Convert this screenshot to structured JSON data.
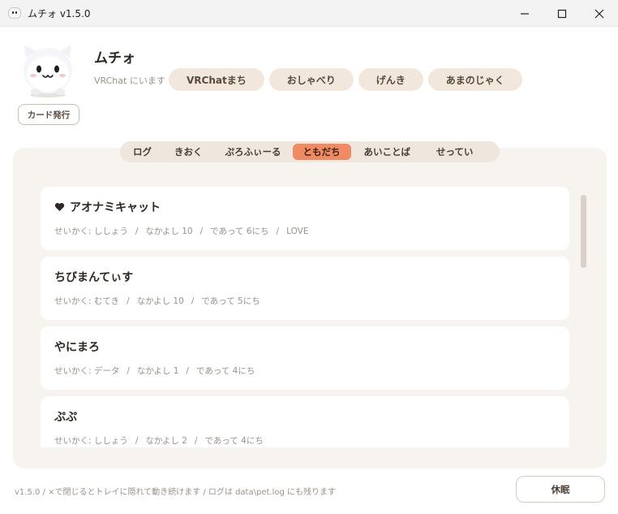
{
  "window": {
    "title": "ムチォ v1.5.0",
    "minimize_icon": "minimize-icon",
    "maximize_icon": "maximize-icon",
    "close_icon": "close-icon"
  },
  "pet": {
    "name": "ムチォ",
    "location": "VRChat にいます",
    "tags": [
      "VRChatまち",
      "おしゃべり",
      "げんき",
      "あまのじゃく"
    ],
    "card_button": "カード発行"
  },
  "tabs": [
    {
      "label": "ログ",
      "active": false
    },
    {
      "label": "きおく",
      "active": false
    },
    {
      "label": "ぷろふぃーる",
      "active": false
    },
    {
      "label": "ともだち",
      "active": true
    },
    {
      "label": "あいことば",
      "active": false
    },
    {
      "label": "せってい",
      "active": false
    }
  ],
  "friends": [
    {
      "name": "アオナミキャット",
      "favorite": true,
      "personality": "せいかく: ししょう",
      "intimacy": "なかよし 10",
      "met": "であって 6にち",
      "extra": "LOVE"
    },
    {
      "name": "ちびまんてぃす",
      "favorite": false,
      "personality": "せいかく: むてき",
      "intimacy": "なかよし 10",
      "met": "であって 5にち",
      "extra": ""
    },
    {
      "name": "やにまろ",
      "favorite": false,
      "personality": "せいかく: データ",
      "intimacy": "なかよし 1",
      "met": "であって 4にち",
      "extra": ""
    },
    {
      "name": "ぷぷ",
      "favorite": false,
      "personality": "せいかく: ししょう",
      "intimacy": "なかよし 2",
      "met": "であって 4にち",
      "extra": ""
    }
  ],
  "footer": {
    "note": "v1.5.0 / ×で閉じるとトレイに隠れて動き続けます / ログは data\\pet.log にも残ります",
    "sleep_button": "休眠"
  },
  "colors": {
    "accent": "#f08a62",
    "panel": "#f7f3ee",
    "tag": "#f2e7dc"
  }
}
